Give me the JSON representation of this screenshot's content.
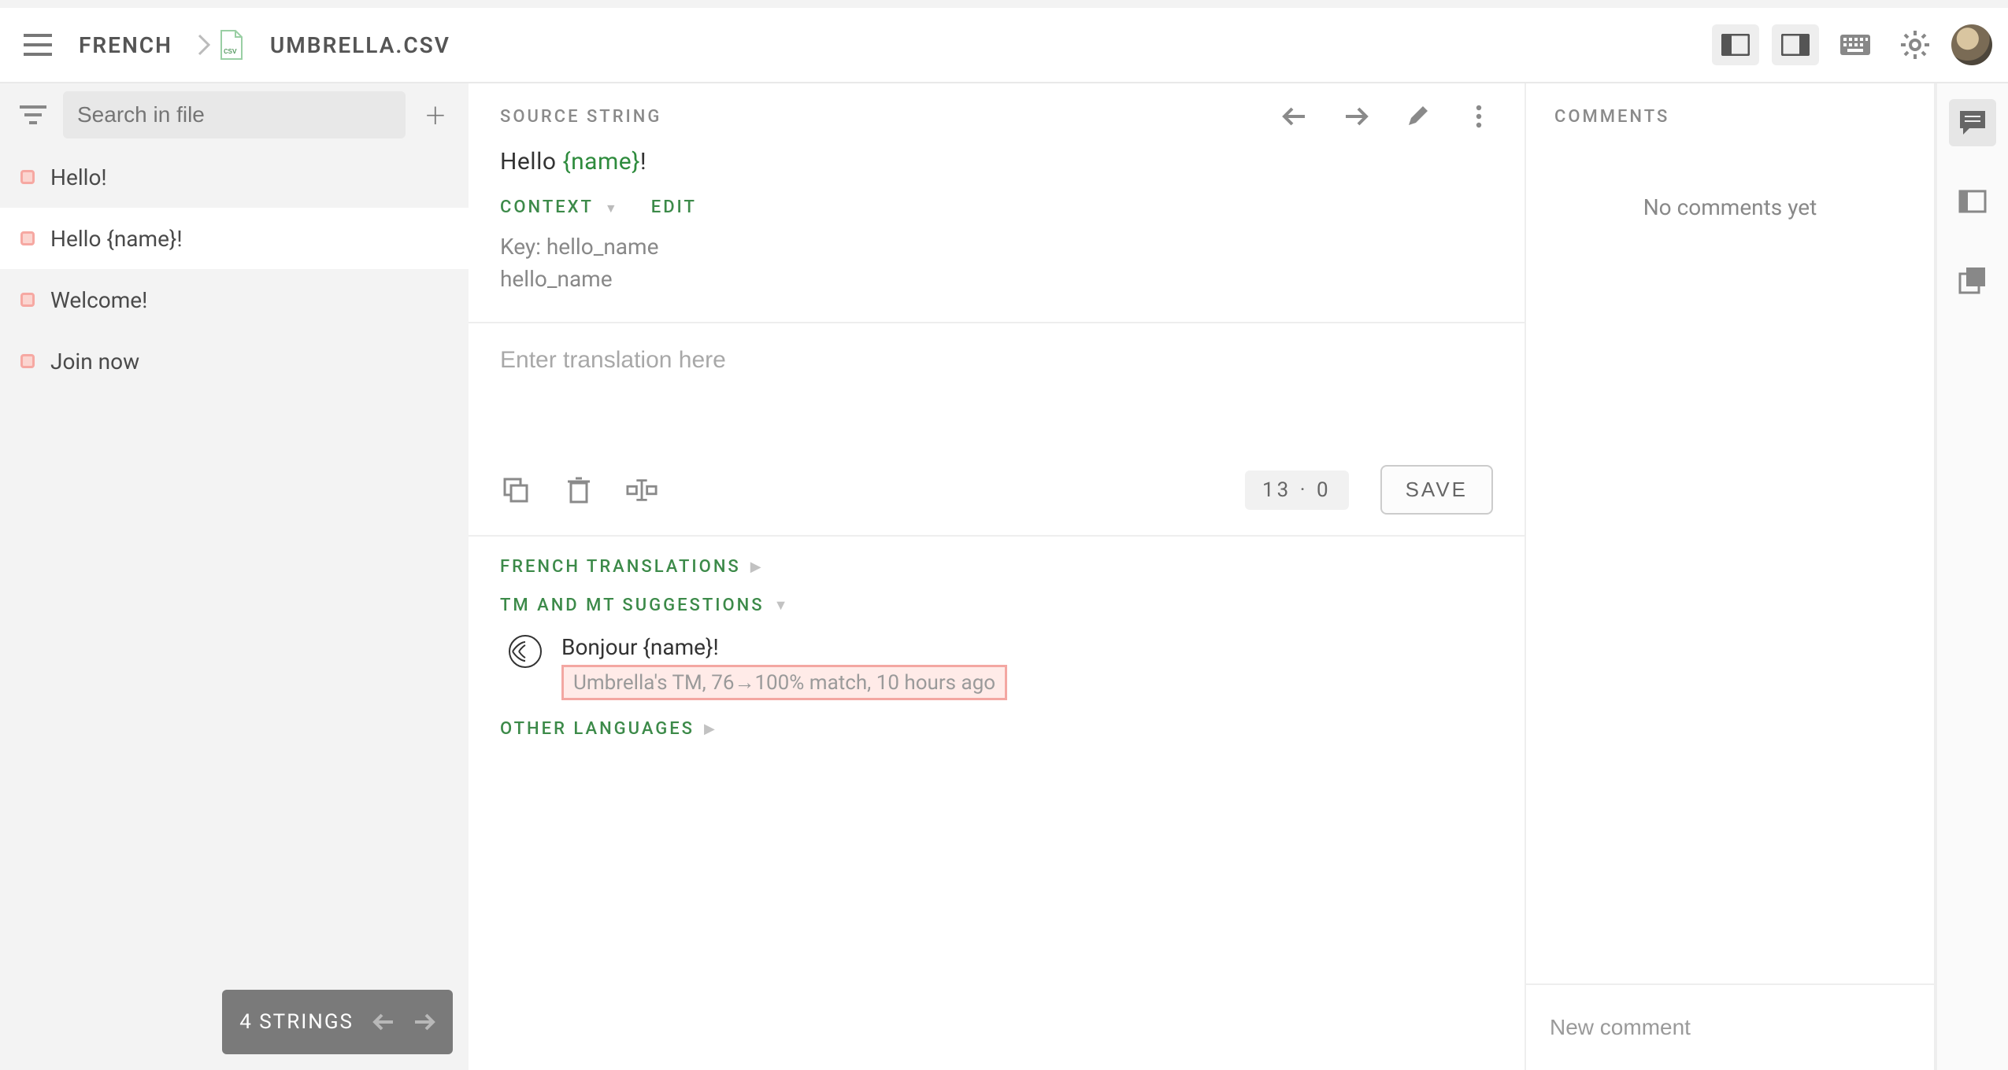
{
  "topbar": {
    "breadcrumb_language": "FRENCH",
    "file_name": "UMBRELLA.CSV"
  },
  "sidebar": {
    "search_placeholder": "Search in file",
    "strings": [
      {
        "text": "Hello!",
        "active": false
      },
      {
        "text": "Hello {name}!",
        "active": true
      },
      {
        "text": "Welcome!",
        "active": false
      },
      {
        "text": "Join now",
        "active": false
      }
    ],
    "footer_count": "4 STRINGS"
  },
  "editor": {
    "source_label": "SOURCE STRING",
    "source_prefix": "Hello ",
    "source_placeholder": "{name}",
    "source_suffix": "!",
    "context_label": "CONTEXT",
    "edit_label": "EDIT",
    "context_key_line": "Key: hello_name",
    "context_val_line": "hello_name",
    "translation_placeholder": "Enter translation here",
    "char_count": "13",
    "char_sep": "·",
    "char_limit": "0",
    "save_label": "SAVE",
    "sections": {
      "french_translations": "FRENCH TRANSLATIONS",
      "tm_suggestions": "TM AND MT SUGGESTIONS",
      "other_languages": "OTHER LANGUAGES"
    },
    "suggestion": {
      "text": "Bonjour {name}!",
      "meta": "Umbrella's TM, 76→100% match, 10 hours ago"
    }
  },
  "comments": {
    "heading": "COMMENTS",
    "empty_text": "No comments yet",
    "new_placeholder": "New comment"
  }
}
